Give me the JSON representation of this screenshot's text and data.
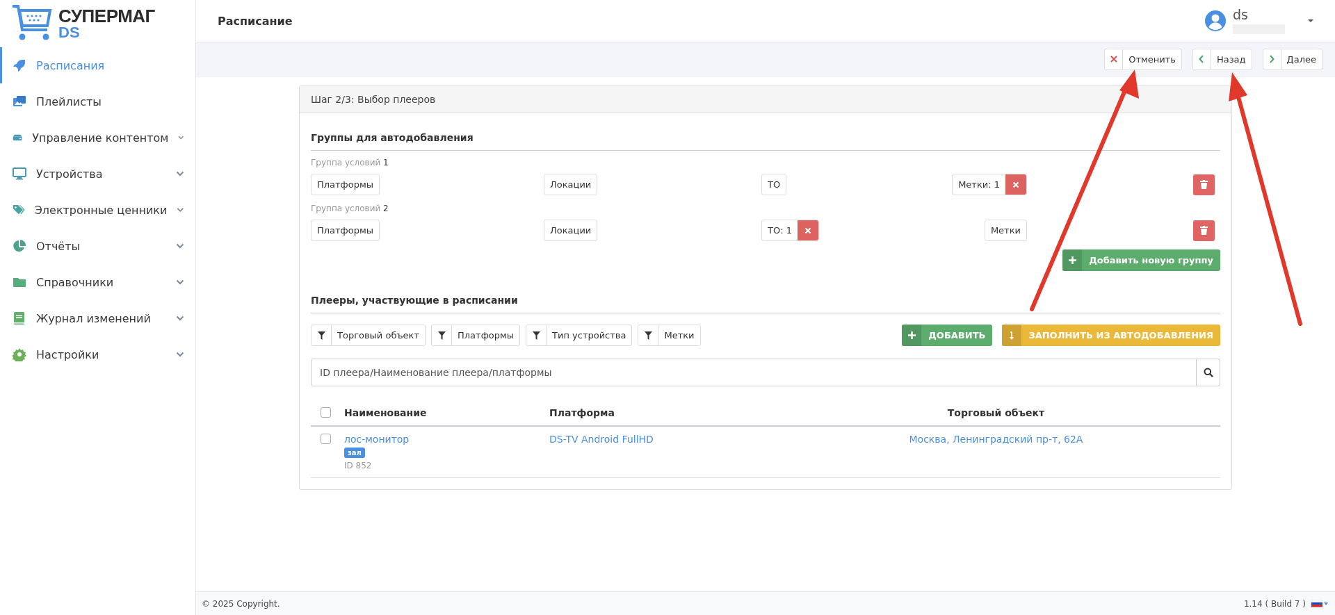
{
  "logo": {
    "title": "СУПЕРМАГ",
    "subtitle": "DS"
  },
  "sidebar": {
    "items": [
      {
        "label": "Расписания",
        "selected": true,
        "expandable": false
      },
      {
        "label": "Плейлисты",
        "selected": false,
        "expandable": false
      },
      {
        "label": "Управление контентом",
        "selected": false,
        "expandable": true
      },
      {
        "label": "Устройства",
        "selected": false,
        "expandable": true
      },
      {
        "label": "Электронные ценники",
        "selected": false,
        "expandable": true
      },
      {
        "label": "Отчёты",
        "selected": false,
        "expandable": true
      },
      {
        "label": "Справочники",
        "selected": false,
        "expandable": true
      },
      {
        "label": "Журнал изменений",
        "selected": false,
        "expandable": true
      },
      {
        "label": "Настройки",
        "selected": false,
        "expandable": true
      }
    ]
  },
  "header": {
    "title": "Расписание",
    "user": "ds"
  },
  "toolbar": {
    "buttons": [
      {
        "label": "Отменить",
        "kind": "cancel"
      },
      {
        "label": "Назад",
        "kind": "back"
      },
      {
        "label": "Далее",
        "kind": "next"
      }
    ]
  },
  "panel": {
    "title": "Шаг 2/3: Выбор плееров",
    "groups_section": {
      "title": "Группы для автодобавления",
      "add_button": "Добавить новую группу",
      "groups": [
        {
          "caption": "Группа условий",
          "number": "1",
          "filters": [
            {
              "label": "Платформы",
              "kind": "empty"
            },
            {
              "label": "Локации",
              "kind": "empty"
            },
            {
              "label": "ТО",
              "kind": "empty"
            },
            {
              "label": "Метки: 1",
              "kind": "set"
            }
          ]
        },
        {
          "caption": "Группа условий",
          "number": "2",
          "filters": [
            {
              "label": "Платформы",
              "kind": "empty"
            },
            {
              "label": "Локации",
              "kind": "empty"
            },
            {
              "label": "ТО: 1",
              "kind": "set"
            },
            {
              "label": "Метки",
              "kind": "empty"
            }
          ]
        }
      ]
    },
    "players_section": {
      "title": "Плееры, участвующие в расписании",
      "filters": [
        "Торговый объект",
        "Платформы",
        "Тип устройства",
        "Метки"
      ],
      "add_button": "ДОБАВИТЬ",
      "fill_button": "ЗАПОЛНИТЬ ИЗ АВТОДОБАВЛЕНИЯ",
      "search": {
        "placeholder": "ID плеера/Наименование плеера/платформы"
      },
      "table": {
        "select_all_checked": false,
        "columns": [
          "Наименование",
          "Платформа",
          "Торговый объект"
        ],
        "rows": [
          {
            "checked": false,
            "name": "лос-монитор",
            "tag": "зал",
            "id": "ID 852",
            "platform": "DS-TV Android FullHD",
            "location": "Москва, Ленинградский пр-т, 62А"
          }
        ]
      }
    }
  },
  "footer": {
    "copyright": "© 2025 Copyright.",
    "version": "1.14 ( Build 7 )"
  }
}
